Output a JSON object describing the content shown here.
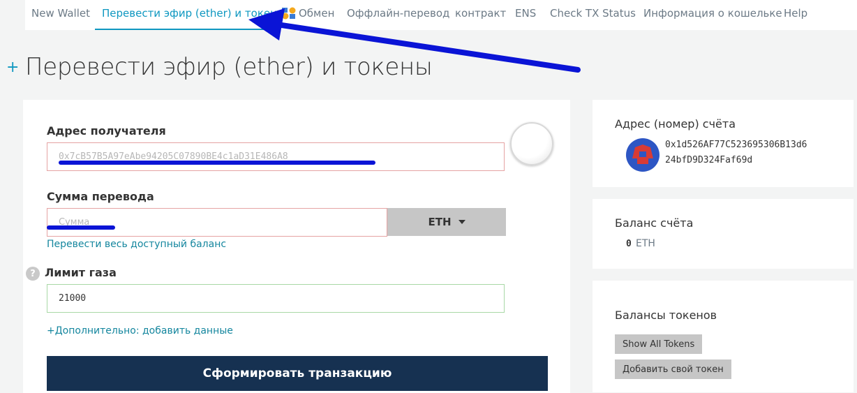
{
  "nav": {
    "items": [
      "New Wallet",
      "Перевести эфир (ether) и токены",
      "Обмен",
      "Оффлайн-перевод",
      "контракт",
      "ENS",
      "Check TX Status",
      "Информация о кошельке",
      "Help"
    ]
  },
  "page": {
    "plus": "+",
    "title": "Перевести эфир (ether) и токены"
  },
  "form": {
    "recipient_label": "Адрес получателя",
    "recipient_placeholder": "0x7cB57B5A97eAbe94205C07890BE4c1aD31E486A8",
    "amount_label": "Сумма перевода",
    "amount_placeholder": "Сумма",
    "unit": "ETH",
    "send_all_link": "Перевести весь доступный баланс",
    "help_glyph": "?",
    "gas_label": "Лимит газа",
    "gas_value": "21000",
    "advanced_link": "+Дополнительно: добавить данные",
    "submit_label": "Сформировать транзакцию"
  },
  "sidebar": {
    "address_label": "Адрес (номер) счёта",
    "address_line1": "0x1d526AF77C523695306B13d6",
    "address_line2": "24bfD9D324Faf69d",
    "balance_label": "Баланс счёта",
    "balance_value": "0",
    "balance_unit": "ETH",
    "tokens_label": "Балансы токенов",
    "show_all_tokens": "Show All Tokens",
    "add_token": "Добавить свой токен"
  },
  "colors": {
    "accent": "#0e97c0",
    "submit_bg": "#163151",
    "annotation": "#0a14d6"
  }
}
